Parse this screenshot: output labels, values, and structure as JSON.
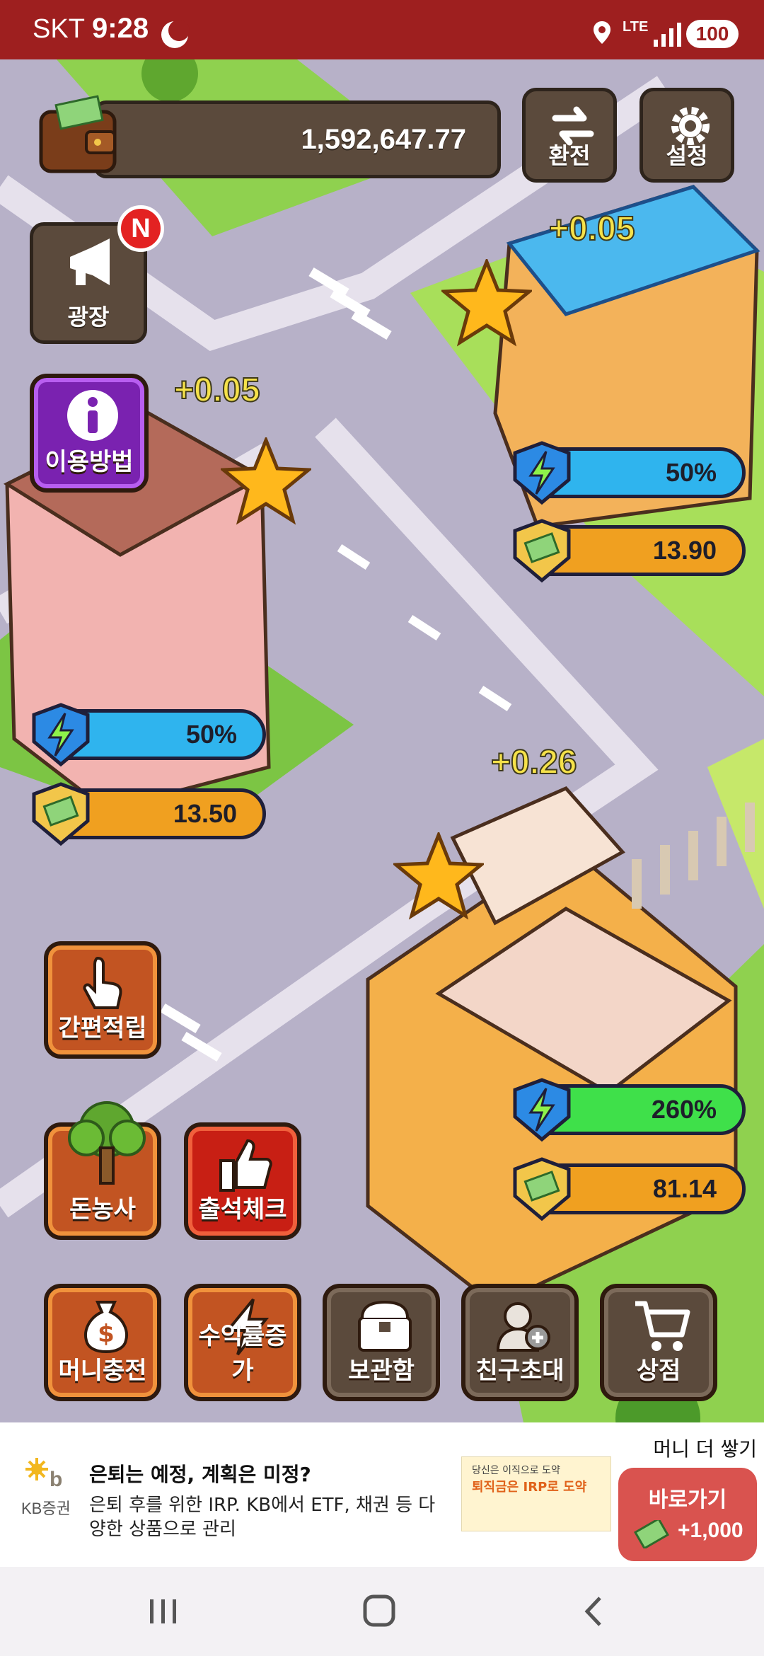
{
  "status_bar": {
    "carrier": "SKT",
    "time": "9:28",
    "network": "LTE",
    "battery": "100"
  },
  "wallet": {
    "balance": "1,592,647.77"
  },
  "top_buttons": {
    "exchange": "환전",
    "settings": "설정",
    "plaza": "광장",
    "plaza_badge": "N",
    "guide": "이용방법"
  },
  "buildings": [
    {
      "rate_plus": "+0.05",
      "boost": "50%",
      "income": "13.90"
    },
    {
      "rate_plus": "+0.05",
      "boost": "50%",
      "income": "13.50"
    },
    {
      "rate_plus": "+0.26",
      "boost": "260%",
      "income": "81.14"
    }
  ],
  "side_buttons": {
    "quick_collect": "간편적립",
    "money_tree": "돈농사",
    "attendance": "출석체크"
  },
  "bottom_buttons": [
    {
      "label": "머니충전",
      "icon": "money-bag-icon"
    },
    {
      "label": "수익률증가",
      "icon": "lightning-icon"
    },
    {
      "label": "보관함",
      "icon": "storage-box-icon"
    },
    {
      "label": "친구초대",
      "icon": "invite-friend-icon"
    },
    {
      "label": "상점",
      "icon": "cart-icon"
    }
  ],
  "ad": {
    "more_label": "머니 더 쌓기",
    "advertiser": "KB증권",
    "headline": "은퇴는 예정, 계획은 미정?",
    "body": "은퇴 후를 위한 IRP. KB에서 ETF, 채권 등 다양한 상품으로 관리",
    "thumb_line1": "당신은 이직으로 도약",
    "thumb_line2": "퇴직금은 IRP로 도약",
    "cta_label": "바로가기",
    "cta_reward": "+1,000"
  },
  "colors": {
    "status_bar": "#9e1f1f",
    "boost_blue": "#2fb4ee",
    "boost_green": "#3fe04a",
    "income_orange": "#f0a020",
    "cta_red": "#d9534f"
  }
}
